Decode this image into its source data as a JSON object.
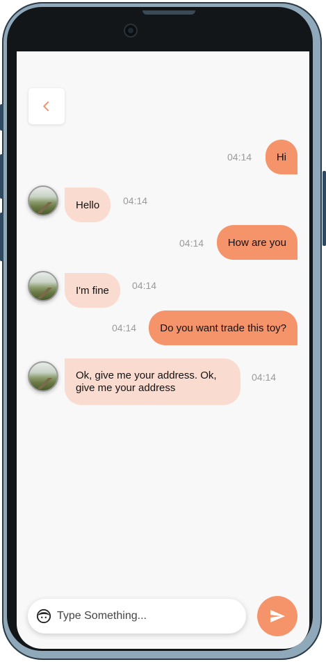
{
  "colors": {
    "accent": "#f5936b",
    "incoming_bubble": "#fadbd0",
    "screen_bg": "#f8f8f8",
    "time_text": "#9a9a9a"
  },
  "header": {
    "back_icon": "chevron-left-icon"
  },
  "messages": [
    {
      "direction": "out",
      "text": "Hi",
      "time": "04:14"
    },
    {
      "direction": "in",
      "text": "Hello",
      "time": "04:14"
    },
    {
      "direction": "out",
      "text": "How are you",
      "time": "04:14"
    },
    {
      "direction": "in",
      "text": "I'm fine",
      "time": "04:14"
    },
    {
      "direction": "out",
      "text": "Do you want trade this toy?",
      "time": "04:14"
    },
    {
      "direction": "in",
      "text": "Ok, give me your address. Ok, give me your address",
      "time": "04:14"
    }
  ],
  "composer": {
    "placeholder": "Type Something...",
    "emoji_icon": "face-icon",
    "send_icon": "send-icon"
  }
}
